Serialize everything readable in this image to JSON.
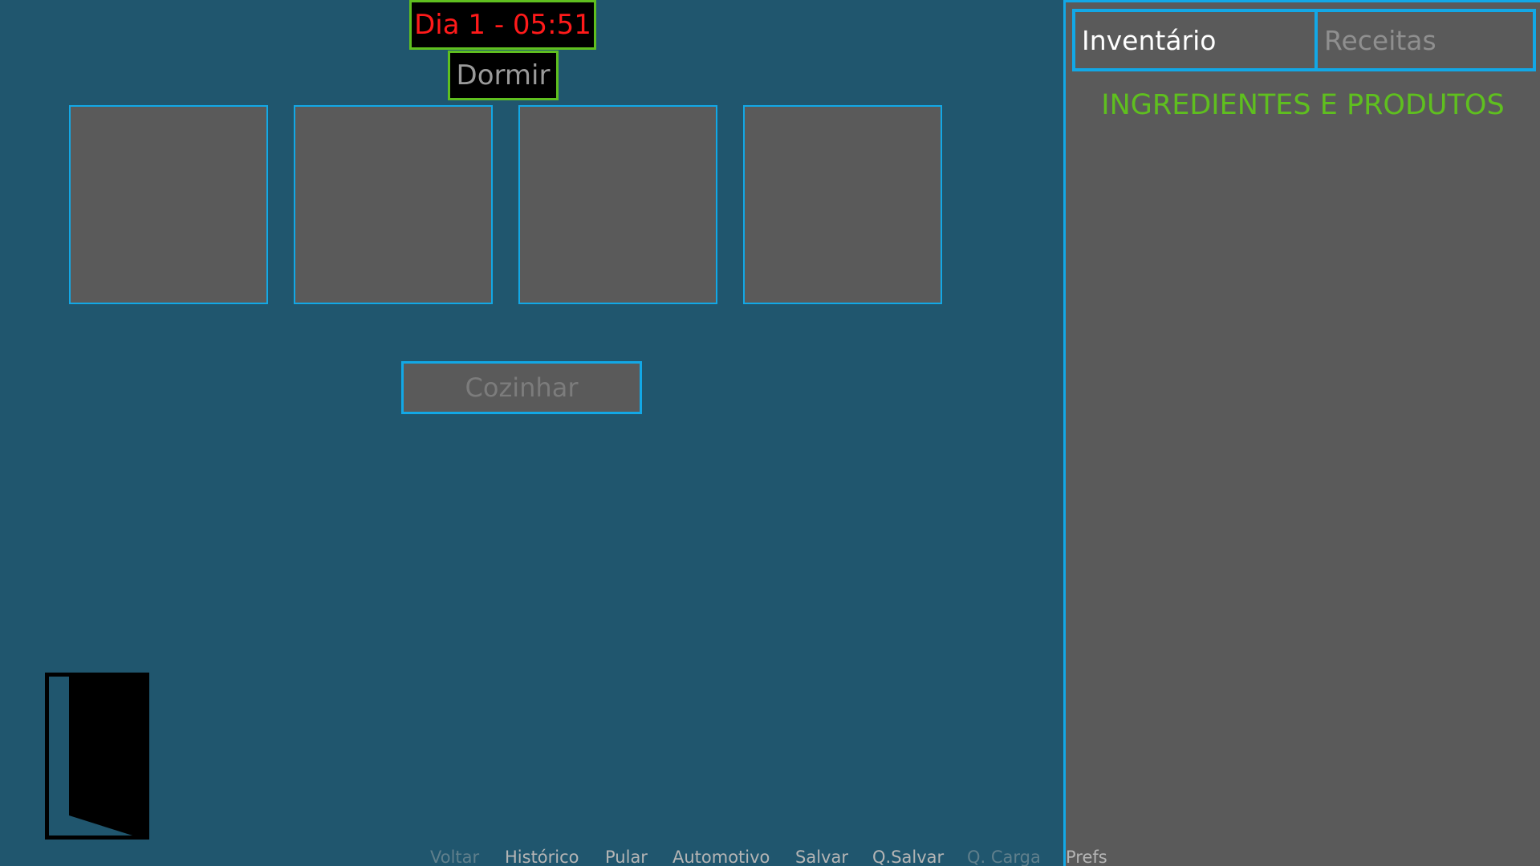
{
  "hud": {
    "clock": "Dia 1 - 05:51",
    "sleep_button": "Dormir"
  },
  "kitchen": {
    "slots": [
      "",
      "",
      "",
      ""
    ],
    "cook_button": "Cozinhar"
  },
  "side_panel": {
    "tabs": [
      {
        "label": "Inventário",
        "active": true
      },
      {
        "label": "Receitas",
        "active": false
      }
    ],
    "heading": "INGREDIENTES E PRODUTOS"
  },
  "quick_menu": {
    "back": "Voltar",
    "history": "Histórico",
    "skip": "Pular",
    "auto": "Automotivo",
    "save": "Salvar",
    "quick_save": "Q.Salvar",
    "quick_load": "Q. Carga",
    "prefs": "Prefs"
  },
  "colors": {
    "background": "#20566e",
    "accent_blue": "#12a8e6",
    "accent_green": "#5fbf1f",
    "clock_text": "#ff1a1a",
    "panel": "#5a5a5a"
  },
  "icons": {
    "exit": "door-icon"
  }
}
